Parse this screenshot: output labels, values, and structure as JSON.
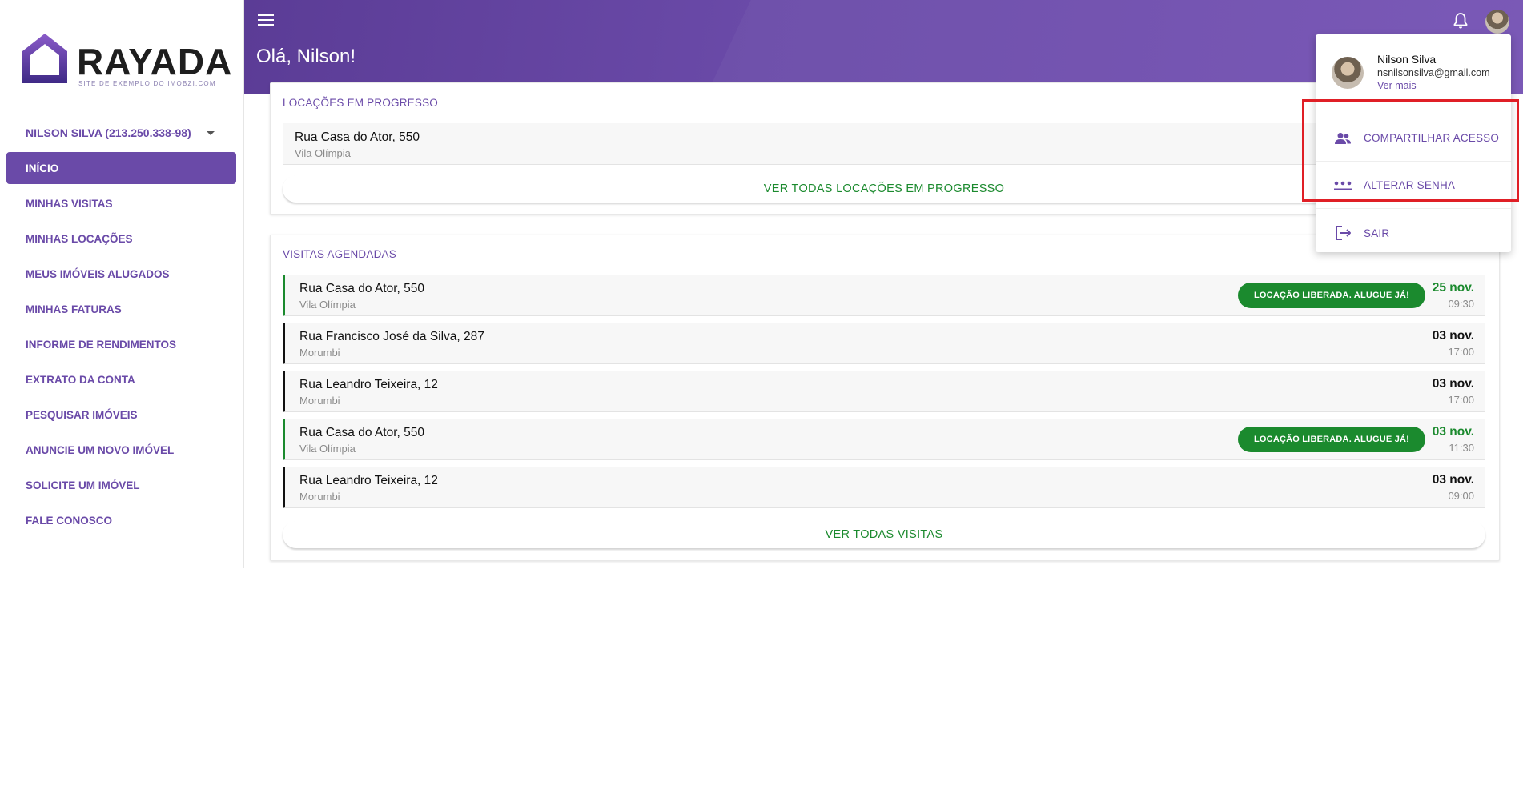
{
  "brand": {
    "name": "RAYADA",
    "tagline": "SITE DE EXEMPLO DO IMOBZI.COM",
    "colors": {
      "primary": "#6a4aa8",
      "accent_green": "#1b8a2e"
    }
  },
  "sidebar": {
    "user_selector": "NILSON SILVA (213.250.338-98)",
    "items": [
      {
        "label": "INÍCIO",
        "active": true
      },
      {
        "label": "MINHAS VISITAS"
      },
      {
        "label": "MINHAS LOCAÇÕES"
      },
      {
        "label": "MEUS IMÓVEIS ALUGADOS"
      },
      {
        "label": "MINHAS FATURAS"
      },
      {
        "label": "INFORME DE RENDIMENTOS"
      },
      {
        "label": "EXTRATO DA CONTA"
      },
      {
        "label": "PESQUISAR IMÓVEIS"
      },
      {
        "label": "ANUNCIE UM NOVO IMÓVEL"
      },
      {
        "label": "SOLICITE UM IMÓVEL"
      },
      {
        "label": "FALE CONOSCO"
      }
    ]
  },
  "header": {
    "greeting": "Olá, Nilson!",
    "icons": [
      "menu-icon",
      "bell-icon",
      "avatar"
    ]
  },
  "rentals": {
    "title": "LOCAÇÕES EM PROGRESSO",
    "items": [
      {
        "street": "Rua Casa do Ator, 550",
        "district": "Vila Olímpia"
      }
    ],
    "see_all": "VER TODAS LOCAÇÕES EM PROGRESSO"
  },
  "visits": {
    "title": "VISITAS AGENDADAS",
    "items": [
      {
        "street": "Rua Casa do Ator, 550",
        "district": "Vila Olímpia",
        "badge": "LOCAÇÃO LIBERADA. ALUGUE JÁ!",
        "day": "25 nov.",
        "time": "09:30",
        "status": "green"
      },
      {
        "street": "Rua Francisco José da Silva, 287",
        "district": "Morumbi",
        "day": "03 nov.",
        "time": "17:00",
        "status": "black"
      },
      {
        "street": "Rua Leandro Teixeira, 12",
        "district": "Morumbi",
        "day": "03 nov.",
        "time": "17:00",
        "status": "black"
      },
      {
        "street": "Rua Casa do Ator, 550",
        "district": "Vila Olímpia",
        "badge": "LOCAÇÃO LIBERADA. ALUGUE JÁ!",
        "day": "03 nov.",
        "time": "11:30",
        "status": "green"
      },
      {
        "street": "Rua Leandro Teixeira, 12",
        "district": "Morumbi",
        "day": "03 nov.",
        "time": "09:00",
        "status": "black"
      }
    ],
    "see_all": "VER TODAS VISITAS"
  },
  "user_menu": {
    "name": "Nilson Silva",
    "email": "nsnilsonsilva@gmail.com",
    "more_link": "Ver mais",
    "items": [
      {
        "label": "COMPARTILHAR ACESSO",
        "icon": "people-icon"
      },
      {
        "label": "ALTERAR SENHA",
        "icon": "password-icon"
      },
      {
        "label": "SAIR",
        "icon": "logout-icon"
      }
    ]
  }
}
